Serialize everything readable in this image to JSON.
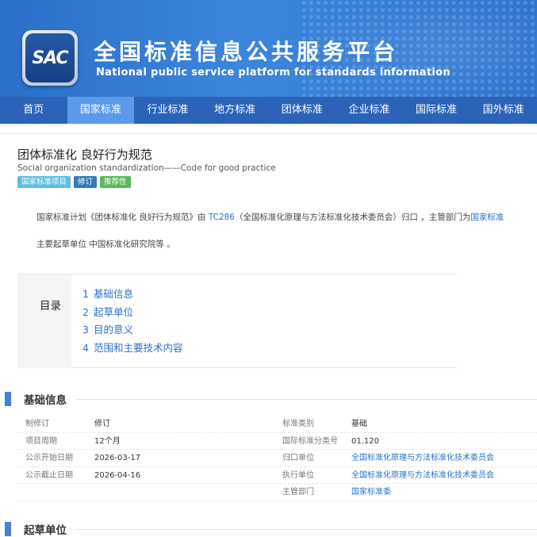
{
  "header": {
    "logo_text": "SAC",
    "title": "全国标准信息公共服务平台",
    "subtitle": "National public service platform  for standards information"
  },
  "nav": {
    "items": [
      {
        "label": "首页",
        "active": false
      },
      {
        "label": "国家标准",
        "active": true
      },
      {
        "label": "行业标准",
        "active": false
      },
      {
        "label": "地方标准",
        "active": false
      },
      {
        "label": "团体标准",
        "active": false
      },
      {
        "label": "企业标准",
        "active": false
      },
      {
        "label": "国际标准",
        "active": false
      },
      {
        "label": "国外标准",
        "active": false
      }
    ]
  },
  "doc": {
    "title": "团体标准化 良好行为规范",
    "title_en": "Social organization standardization——Code for good practice",
    "tags": [
      "国家标准项目",
      "修订",
      "推荐性"
    ],
    "intro_prefix": "国家标准计划《团体标准化 良好行为规范》由 ",
    "intro_tc": "TC286",
    "intro_middle": "（全国标准化原理与方法标准化技术委员会）归口 ，主管部门为",
    "intro_dept": "国家标准",
    "intro_line2": "主要起草单位 中国标准化研究院等 。"
  },
  "toc": {
    "heading": "目录",
    "items": [
      {
        "num": "1",
        "label": "基础信息"
      },
      {
        "num": "2",
        "label": "起草单位"
      },
      {
        "num": "3",
        "label": "目的意义"
      },
      {
        "num": "4",
        "label": "范围和主要技术内容"
      }
    ]
  },
  "basic_info": {
    "heading": "基础信息",
    "rows": [
      {
        "l1": "制修订",
        "v1": "修订",
        "l2": "标准类别",
        "v2": "基础",
        "v2_link": false
      },
      {
        "l1": "项目周期",
        "v1": "12个月",
        "l2": "国际标准分类号",
        "v2": "01.120",
        "v2_link": false
      },
      {
        "l1": "公示开始日期",
        "v1": "2026-03-17",
        "l2": "归口单位",
        "v2": "全国标准化原理与方法标准化技术委员会",
        "v2_link": true
      },
      {
        "l1": "公示截止日期",
        "v1": "2026-04-16",
        "l2": "执行单位",
        "v2": "全国标准化原理与方法标准化技术委员会",
        "v2_link": true
      },
      {
        "l1": "",
        "v1": "",
        "l2": "主管部门",
        "v2": "国家标准委",
        "v2_link": true
      }
    ]
  },
  "drafting": {
    "heading": "起草单位"
  }
}
